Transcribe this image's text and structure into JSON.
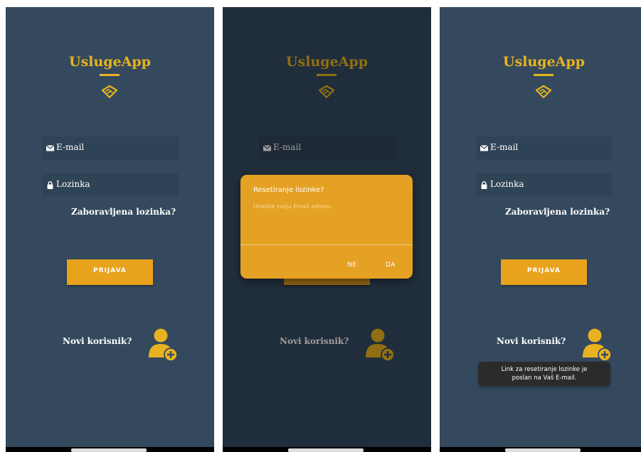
{
  "app": {
    "name": "UslugeApp"
  },
  "login": {
    "email_placeholder": "E-mail",
    "password_placeholder": "Lozinka",
    "forgot_password": "Zaboravljena lozinka?",
    "login_button": "PRIJAVA",
    "new_user": "Novi korisnik?"
  },
  "reset_dialog": {
    "title": "Resetiranje lozinke?",
    "hint": "Unesite svoju Email adresu.",
    "no_button": "NE",
    "yes_button": "DA"
  },
  "toast": {
    "message": "Link za resetiranje lozinke je\nposlan na Vaš E-mail."
  },
  "icons": {
    "logo": "handshake-icon",
    "email_field": "envelope-icon",
    "password_field": "lock-icon",
    "register": "add-user-icon"
  },
  "colors": {
    "background": "#34495e",
    "field": "#2f4356",
    "accent": "#e8b320",
    "button": "#e8a21c",
    "dialog": "#e4a124",
    "toast": "#2b2b2b"
  }
}
